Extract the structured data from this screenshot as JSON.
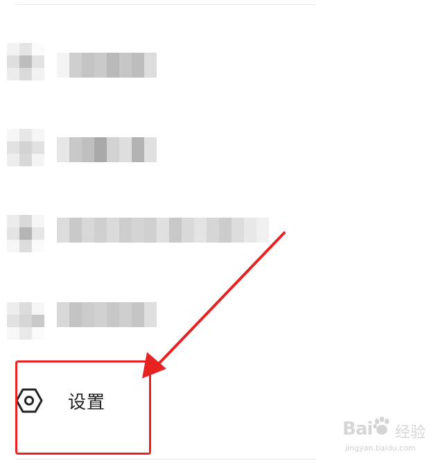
{
  "menu": {
    "settings_label": "设置",
    "settings_icon": "hexagon-gear-icon"
  },
  "annotation": {
    "color": "#e62222"
  },
  "watermark": {
    "url": "jingyan.baidu.com"
  }
}
